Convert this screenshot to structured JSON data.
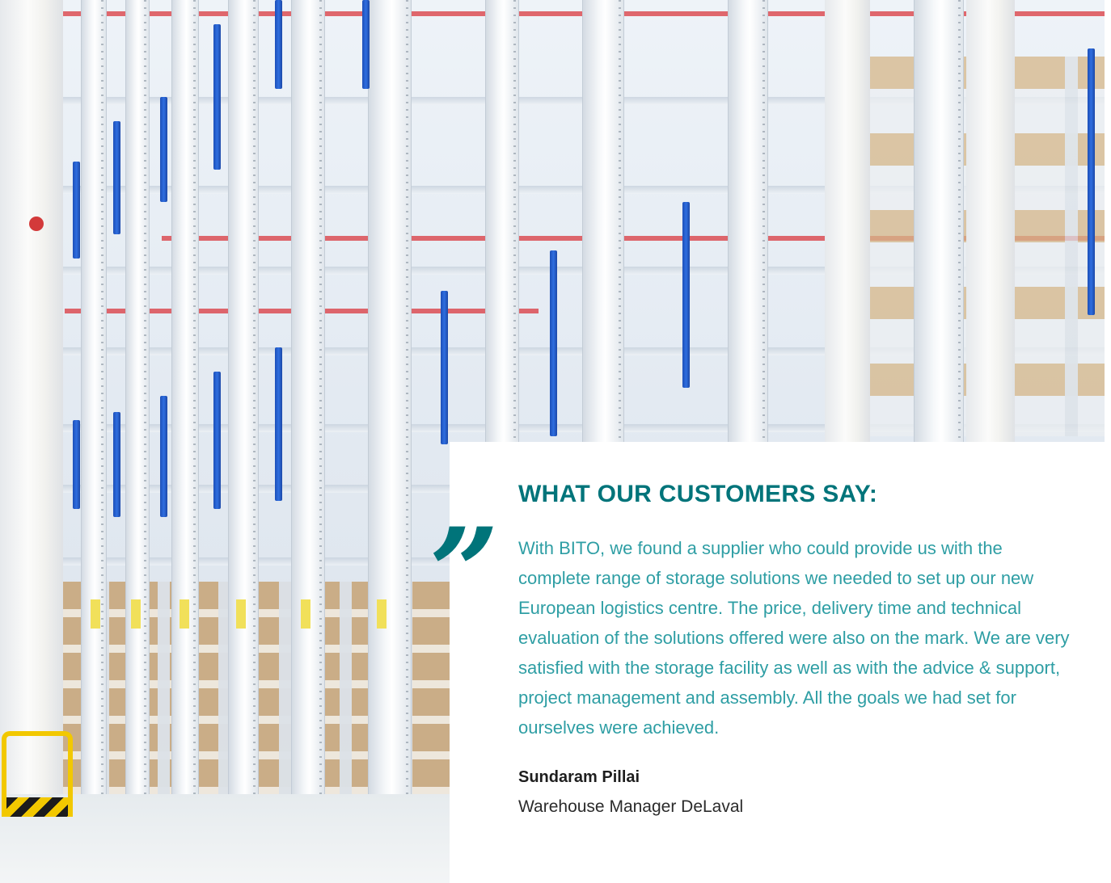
{
  "testimonial": {
    "heading": "WHAT OUR CUSTOMERS SAY:",
    "quote_mark": "”",
    "quote": "With BITO, we found a supplier who could provide us with the complete range of storage solutions we needed to set up our new European logistics centre. The price, delivery time and technical evaluation of the solutions offered were also on the mark. We are very satisfied with the storage facility as well as with the advice & support, project management and assembly. All the goals we had set for ourselves were achieved.",
    "author_name": "Sundaram Pillai",
    "author_role": "Warehouse Manager DeLaval"
  },
  "colors": {
    "accent_dark": "#00747a",
    "accent_light": "#2e9ea4",
    "text_dark": "#1e1e1e"
  },
  "photo": {
    "subject": "warehouse-shelving-photo"
  }
}
